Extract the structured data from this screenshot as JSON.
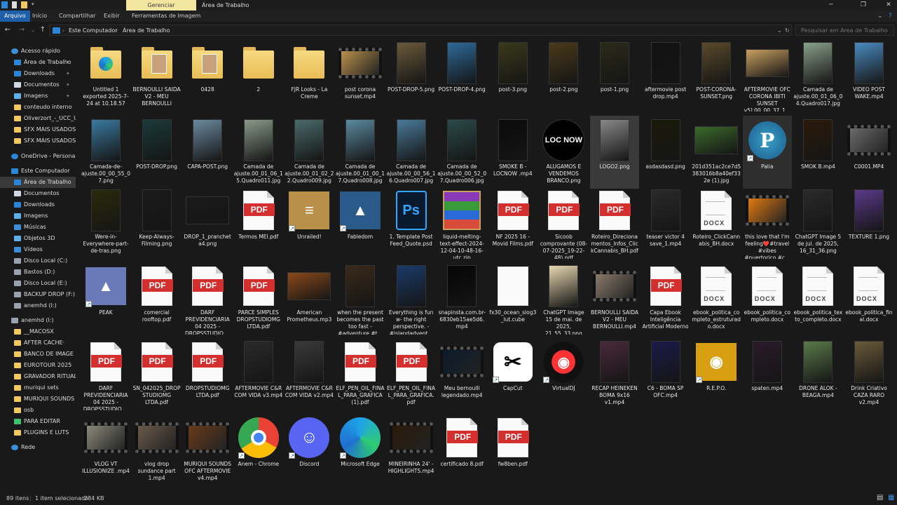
{
  "window": {
    "title": "Área de Trabalho",
    "context_tab": "Gerenciar",
    "controls": [
      "─",
      "❐",
      "✕"
    ]
  },
  "ribbon": {
    "tabs": [
      "Arquivo",
      "Início",
      "Compartilhar",
      "Exibir",
      "Ferramentas de Imagem"
    ],
    "active": "Arquivo"
  },
  "address": {
    "crumbs": [
      "Este Computador",
      "Área de Trabalho"
    ],
    "search_placeholder": "Pesquisar em Área de Trabalho"
  },
  "sidebar": [
    {
      "label": "Acesso rápido",
      "icon": "star-icon",
      "color": "#3b8fd9",
      "indent": 0
    },
    {
      "label": "Área de Trabalho",
      "icon": "desktop-icon",
      "color": "#2b86d8",
      "indent": 1,
      "pin": true
    },
    {
      "label": "Downloads",
      "icon": "download-icon",
      "color": "#2b86d8",
      "indent": 1,
      "pin": true
    },
    {
      "label": "Documentos",
      "icon": "document-icon",
      "color": "#cfd8e3",
      "indent": 1,
      "pin": true
    },
    {
      "label": "Imagens",
      "icon": "image-icon",
      "color": "#5fb0e8",
      "indent": 1,
      "pin": true
    },
    {
      "label": "conteudo interno",
      "icon": "folder-icon",
      "color": "#f0c862",
      "indent": 1
    },
    {
      "label": "Oliverzort_-_UCC_U",
      "icon": "folder-icon",
      "color": "#f0c862",
      "indent": 1
    },
    {
      "label": "SFX MAIS USADOS",
      "icon": "folder-icon",
      "color": "#f0c862",
      "indent": 1
    },
    {
      "label": "SFX MAIS USADOS",
      "icon": "folder-icon",
      "color": "#f0c862",
      "indent": 1
    },
    {
      "label": "OneDrive - Personal",
      "icon": "cloud-icon",
      "color": "#2b86d8",
      "indent": 0
    },
    {
      "label": "Este Computador",
      "icon": "computer-icon",
      "color": "#2b86d8",
      "indent": 0
    },
    {
      "label": "Área de Trabalho",
      "icon": "desktop-icon",
      "color": "#2b86d8",
      "indent": 1,
      "selected": true
    },
    {
      "label": "Documentos",
      "icon": "document-icon",
      "color": "#cfd8e3",
      "indent": 1
    },
    {
      "label": "Downloads",
      "icon": "download-icon",
      "color": "#2b86d8",
      "indent": 1
    },
    {
      "label": "Imagens",
      "icon": "image-icon",
      "color": "#5fb0e8",
      "indent": 1
    },
    {
      "label": "Músicas",
      "icon": "music-icon",
      "color": "#3b8fd9",
      "indent": 1
    },
    {
      "label": "Objetos 3D",
      "icon": "cube-icon",
      "color": "#5fb0e8",
      "indent": 1
    },
    {
      "label": "Vídeos",
      "icon": "video-icon",
      "color": "#3b8fd9",
      "indent": 1
    },
    {
      "label": "Disco Local (C:)",
      "icon": "drive-icon",
      "color": "#9aa3ad",
      "indent": 1
    },
    {
      "label": "Bastos (D:)",
      "icon": "drive-icon",
      "color": "#9aa3ad",
      "indent": 1
    },
    {
      "label": "Disco Local (E:)",
      "icon": "drive-icon",
      "color": "#9aa3ad",
      "indent": 1
    },
    {
      "label": "BACKUP DROP (F:)",
      "icon": "drive-icon",
      "color": "#9aa3ad",
      "indent": 1
    },
    {
      "label": "anemhd (I:)",
      "icon": "drive-icon",
      "color": "#9aa3ad",
      "indent": 1
    },
    {
      "label": "anemhd (I:)",
      "icon": "drive-icon",
      "color": "#9aa3ad",
      "indent": 0
    },
    {
      "label": "__MACOSX",
      "icon": "folder-icon",
      "color": "#f0c862",
      "indent": 1
    },
    {
      "label": "AFTER CACHE·",
      "icon": "folder-icon",
      "color": "#f0c862",
      "indent": 1
    },
    {
      "label": "BANCO DE IMAGE",
      "icon": "folder-icon",
      "color": "#f0c862",
      "indent": 1
    },
    {
      "label": "EUROTOUR 2025",
      "icon": "folder-icon",
      "color": "#f0c862",
      "indent": 1
    },
    {
      "label": "GRAVADOR RITUAL",
      "icon": "folder-icon",
      "color": "#f0c862",
      "indent": 1
    },
    {
      "label": "muriqui sets",
      "icon": "folder-icon",
      "color": "#f0c862",
      "indent": 1
    },
    {
      "label": "MURIQUI SOUNDS",
      "icon": "folder-icon",
      "color": "#f0c862",
      "indent": 1
    },
    {
      "label": "osb",
      "icon": "folder-icon",
      "color": "#f0c862",
      "indent": 1
    },
    {
      "label": "PARA EDITAR",
      "icon": "leaf-icon",
      "color": "#3fbf6f",
      "indent": 1
    },
    {
      "label": "PLUGINS E LUTS",
      "icon": "folder-icon",
      "color": "#f0c862",
      "indent": 1
    },
    {
      "label": "Rede",
      "icon": "network-icon",
      "color": "#3b8fd9",
      "indent": 0
    }
  ],
  "files": [
    [
      {
        "name": "Untitled 1 exported 2025-7-24 at 10.18.57",
        "kind": "folder",
        "icon": "edge-folder-icon"
      },
      {
        "name": "BERNOULLI SAIDA V2 - MEU BERNOULLI",
        "kind": "folder",
        "icon": "photo-folder-icon"
      },
      {
        "name": "0428",
        "kind": "folder",
        "icon": "photo-folder-icon"
      },
      {
        "name": "2",
        "kind": "folder",
        "icon": "folder-icon"
      },
      {
        "name": "FJR Looks - La Creme",
        "kind": "folder",
        "icon": "folder-icon"
      },
      {
        "name": "post corona sunset.mp4",
        "kind": "video",
        "color": "#b8904a"
      },
      {
        "name": "POST-DROP-5.png",
        "kind": "photo",
        "color": "#6a5a3a"
      },
      {
        "name": "POST-DROP-4.png",
        "kind": "photo",
        "color": "#2d6a9a"
      },
      {
        "name": "post-3.png",
        "kind": "photo",
        "color": "#3a3a1a"
      },
      {
        "name": "post-2.png",
        "kind": "photo",
        "color": "#4a3a1a"
      },
      {
        "name": "post-1.png",
        "kind": "photo",
        "color": "#2a2a1a"
      },
      {
        "name": "aftermovie post drop.mp4",
        "kind": "photo",
        "color": "#111"
      },
      {
        "name": "POST-CORONA-SUNSET.png",
        "kind": "photo",
        "color": "#5a4a2a"
      },
      {
        "name": "AFTERMOVIE OFC CORONA IBITI SUNSET v5].00_00_37_1...",
        "kind": "photoland",
        "color": "#c8a060"
      },
      {
        "name": "Camada de ajuste.00_01_06_04.Quadro017.jpg",
        "kind": "photo",
        "color": "#8aa08a"
      },
      {
        "name": "VIDEO POST WAKE.mp4",
        "kind": "photo",
        "color": "#4a8ac0"
      }
    ],
    [
      {
        "name": "Camada-de-ajuste.00_00_55_07.png",
        "kind": "photo",
        "color": "#3a7aa0"
      },
      {
        "name": "POST-DROP.png",
        "kind": "photo",
        "color": "#1a3a3a"
      },
      {
        "name": "CAPA-POST.png",
        "kind": "photo",
        "color": "#6a8aa0"
      },
      {
        "name": "Camada de ajuste.00_01_06_15.Quadro011.jpg",
        "kind": "photo",
        "color": "#8a9a8a"
      },
      {
        "name": "Camada de ajuste.00_01_02_22.Quadro009.jpg",
        "kind": "photo",
        "color": "#4a6a6a"
      },
      {
        "name": "Camada de ajuste.00_01_00_17.Quadro008.jpg",
        "kind": "photo",
        "color": "#5a8aa0"
      },
      {
        "name": "Camada de ajuste.00_00_56_16.Quadro007.jpg",
        "kind": "photo",
        "color": "#4a7a9a"
      },
      {
        "name": "Camada de ajuste.00_00_52_07.Quadro006.jpg",
        "kind": "photo",
        "color": "#2a4a4a"
      },
      {
        "name": "SMOKE B - LOCNOW .mp4",
        "kind": "photo",
        "color": "#0a0a0a"
      },
      {
        "name": "ALUGAMOS E VENDEMOS BRANCO.png",
        "kind": "loc"
      },
      {
        "name": "LOGO2.png",
        "kind": "photo",
        "color": "#888",
        "selected": true
      },
      {
        "name": "asdasdasd.png",
        "kind": "photo",
        "color": "#1a1a0a"
      },
      {
        "name": "201d351ac2ce7d5383016b8a40ef332e (1).jpg",
        "kind": "photoland",
        "color": "#3a6a2a"
      },
      {
        "name": "Palia",
        "kind": "palia",
        "hover": true
      },
      {
        "name": "SMOK B.mp4",
        "kind": "photo",
        "color": "#2a1a0a"
      },
      {
        "name": "C0001.MP4",
        "kind": "video",
        "color": "#6a6a6a"
      }
    ],
    [
      {
        "name": "Were-in-Everywhere-part-de-tras.png",
        "kind": "photo",
        "color": "#2a2a0a"
      },
      {
        "name": "Keep-Always-Filming.png",
        "kind": "photo",
        "color": "#1a1a1a"
      },
      {
        "name": "DROP_1_prancheta4.png",
        "kind": "photoland",
        "color": "#1a1a1a"
      },
      {
        "name": "Termos MEI.pdf",
        "kind": "pdf"
      },
      {
        "name": "Unrailed!",
        "kind": "app",
        "color": "#b8904a",
        "text": "≡",
        "shortcut": true
      },
      {
        "name": "Fabledom",
        "kind": "app",
        "color": "#2a5a8a",
        "text": "▲",
        "shortcut": true
      },
      {
        "name": "1. Template Post Feed_Quote.psd",
        "kind": "psd"
      },
      {
        "name": "liquid-melting-text-effect-2024-12-04-10-48-16-utc.zip",
        "kind": "winrar"
      },
      {
        "name": "NF 2025 16 - Movid Films.pdf",
        "kind": "pdf"
      },
      {
        "name": "Sicoob comprovante (08-07-2025_19-22-48).pdf",
        "kind": "pdf"
      },
      {
        "name": "Roteiro_Direcionamentos_Infos_ClickCannabis_BH.pdf",
        "kind": "pdf"
      },
      {
        "name": "teaser victor 4 save_1.mp4",
        "kind": "photo",
        "color": "#2a2a2a"
      },
      {
        "name": "Roteiro_ClickCannabis_BH.docx",
        "kind": "docx"
      },
      {
        "name": "this love that I'm feeling❤️#travel #vibes #puertorico #c...",
        "kind": "video",
        "color": "#e07a10"
      },
      {
        "name": "ChatGPT Image 5 de jul. de 2025, 16_31_36.png",
        "kind": "photo",
        "color": "#2a2a2a"
      },
      {
        "name": "TEXTURE 1.png",
        "kind": "photo",
        "color": "#5a3a8a"
      }
    ],
    [
      {
        "name": "PEAK",
        "kind": "app",
        "color": "#6a7ab8",
        "text": "▲",
        "shortcut": true
      },
      {
        "name": "comercial rooftop.pdf",
        "kind": "pdf"
      },
      {
        "name": "DARF PREVIDENCIARIA 04 2025 - DROPSSTUDIO ...",
        "kind": "pdf"
      },
      {
        "name": "PARCE SIMPLES DROPSTUDIOMG LTDA.pdf",
        "kind": "pdf"
      },
      {
        "name": "American Prometheus.mp3",
        "kind": "photoland",
        "color": "#8a4a1a"
      },
      {
        "name": "when the present becomes the past too fast -#adventure #t...",
        "kind": "photo",
        "color": "#3a2a1a"
      },
      {
        "name": "Everything is fun w- the right perspective. -#islandadvent...",
        "kind": "photo",
        "color": "#1a3a6a"
      },
      {
        "name": "snapinsta.com.br-6830eb15ae5d6.mp4",
        "kind": "photo",
        "color": "#050505"
      },
      {
        "name": "fx30_ocean_slog3_lut.cube",
        "kind": "blank"
      },
      {
        "name": "ChatGPT Image 15 de mai. de 2025, 21_55_33.png",
        "kind": "photo",
        "color": "#e8d8b0"
      },
      {
        "name": "BERNOULLI SAIDA V2 - MEU BERNOULLI.mp4",
        "kind": "video",
        "color": "#8a7a6a"
      },
      {
        "name": "Capa Ebook Inteligência Artificial Moderno ...",
        "kind": "pdf"
      },
      {
        "name": "ebook_politica_completo_estruturado.docx",
        "kind": "docx"
      },
      {
        "name": "ebook_politica_completo.docx",
        "kind": "docx"
      },
      {
        "name": "ebook_politica_texto_completo.docx",
        "kind": "docx"
      },
      {
        "name": "ebook_politica_final.docx",
        "kind": "docx"
      }
    ],
    [
      {
        "name": "DARF PREVIDENCIARIA 04 2025 - DROPSSTUDIO ...",
        "kind": "pdf"
      },
      {
        "name": "SN_042025_DROPSTUDIOMG LTDA.pdf",
        "kind": "pdf"
      },
      {
        "name": "DROPSTUDIOMG LTDA.pdf",
        "kind": "pdf"
      },
      {
        "name": "AFTERMOVIE C&R COM VIDA v3.mp4",
        "kind": "photo",
        "color": "#2a2a2a"
      },
      {
        "name": "AFTERMOVIE C&R COM VIDA v2.mp4",
        "kind": "photo",
        "color": "#3a3a3a"
      },
      {
        "name": "ELF_PEN_OIL_FINAL_PARA_GRAFICA (1).pdf",
        "kind": "pdf"
      },
      {
        "name": "ELF_PEN_OIL_FINAL_PARA_GRAFICA.pdf",
        "kind": "pdf"
      },
      {
        "name": "Meu bernoulli legendado.mp4",
        "kind": "video",
        "color": "#0a1a2a"
      },
      {
        "name": "CapCut",
        "kind": "capcut"
      },
      {
        "name": "VirtualDJ",
        "kind": "vdj"
      },
      {
        "name": "RECAP HEINEKEN BOMA 9x16 v1.mp4",
        "kind": "photo",
        "color": "#4a2a3a"
      },
      {
        "name": "C6 - BOMA SP OFC.mp4",
        "kind": "photo",
        "color": "#1a1a4a"
      },
      {
        "name": "R.E.P.O.",
        "kind": "app",
        "color": "#d8a010",
        "text": "◉",
        "shortcut": true
      },
      {
        "name": "spaten.mp4",
        "kind": "photo",
        "color": "#2a1a2a"
      },
      {
        "name": "DRONE ALOK - BEAGA.mp4",
        "kind": "photo",
        "color": "#5a7a4a"
      },
      {
        "name": "Drink Criativo CAZA RARO v2.mp4",
        "kind": "photo",
        "color": "#6a5a3a"
      }
    ],
    [
      {
        "name": "VLOG VT ILLUSIONIZE .mp4",
        "kind": "video",
        "color": "#8a8a7a"
      },
      {
        "name": "vlog drop sundance part 1.mp4",
        "kind": "video",
        "color": "#6a5a4a"
      },
      {
        "name": "MURIQUI SOUNDS OFC AFTERMOVIE v4.mp4",
        "kind": "video",
        "color": "#6a3a1a"
      },
      {
        "name": "Anem - Chrome",
        "kind": "chrome"
      },
      {
        "name": "Discord",
        "kind": "discord"
      },
      {
        "name": "Microsoft Edge",
        "kind": "edge"
      },
      {
        "name": "MINEIRINHA 24' - HIGHLIGHTS.mp4",
        "kind": "video",
        "color": "#2a1a0a"
      },
      {
        "name": "certificado 8.pdf",
        "kind": "pdf"
      },
      {
        "name": "fw8ben.pdf",
        "kind": "pdf"
      }
    ]
  ],
  "status": {
    "count": "89 itens",
    "selection": "1 item selecionado",
    "size": "284 KB"
  }
}
